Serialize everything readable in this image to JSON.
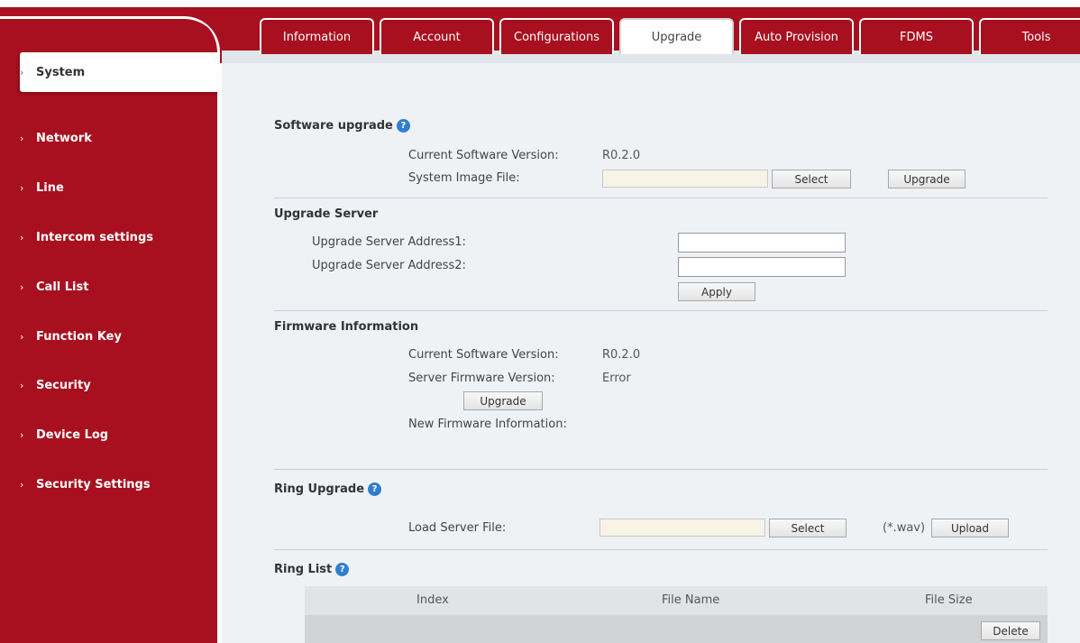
{
  "tabs": [
    "Information",
    "Account",
    "Configurations",
    "Upgrade",
    "Auto Provision",
    "FDMS",
    "Tools"
  ],
  "active_tab": "Upgrade",
  "sidebar": {
    "items": [
      "System",
      "Network",
      "Line",
      "Intercom settings",
      "Call List",
      "Function Key",
      "Security",
      "Device Log",
      "Security Settings"
    ],
    "active": "System",
    "chevron": "›"
  },
  "software_upgrade": {
    "title": "Software upgrade",
    "current_version_label": "Current Software Version:",
    "current_version_value": "R0.2.0",
    "image_file_label": "System Image File:",
    "image_file_value": "",
    "select_button": "Select",
    "upgrade_button": "Upgrade"
  },
  "upgrade_server": {
    "title": "Upgrade Server",
    "address1_label": "Upgrade Server Address1:",
    "address1_value": "",
    "address2_label": "Upgrade Server Address2:",
    "address2_value": "",
    "apply_button": "Apply"
  },
  "firmware_info": {
    "title": "Firmware Information",
    "current_version_label": "Current Software Version:",
    "current_version_value": "R0.2.0",
    "server_version_label": "Server Firmware Version:",
    "server_version_value": "Error",
    "upgrade_button": "Upgrade",
    "new_firmware_label": "New Firmware Information:"
  },
  "ring_upgrade": {
    "title": "Ring Upgrade",
    "load_file_label": "Load Server File:",
    "file_value": "",
    "select_button": "Select",
    "format_hint": "(*.wav)",
    "upload_button": "Upload"
  },
  "ring_list": {
    "title": "Ring List",
    "columns": [
      "Index",
      "File Name",
      "File Size"
    ],
    "delete_button": "Delete"
  },
  "icons": {
    "help": "question-circle-icon",
    "chevron": "chevron-right-icon"
  },
  "colors": {
    "brand_red": "#a8101f",
    "help_blue": "#2f7fcf",
    "content_bg": "#eef2f5"
  }
}
